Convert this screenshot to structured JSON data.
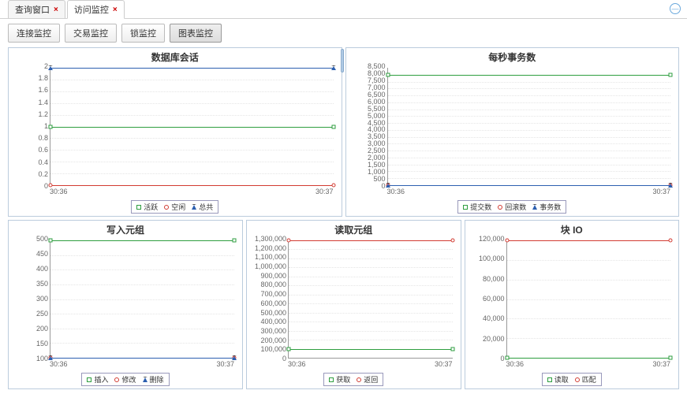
{
  "tabs": [
    {
      "label": "查询窗口",
      "active": false
    },
    {
      "label": "访问监控",
      "active": true
    }
  ],
  "subtabs": [
    {
      "label": "连接监控",
      "active": false
    },
    {
      "label": "交易监控",
      "active": false
    },
    {
      "label": "锁监控",
      "active": false
    },
    {
      "label": "图表监控",
      "active": true
    }
  ],
  "colors": {
    "green": "#2e9e3f",
    "red": "#d23b32",
    "blue": "#2c5fb0"
  },
  "xticks": [
    "30:36",
    "30:37"
  ],
  "chart_data": [
    {
      "id": "sessions",
      "title": "数据库会话",
      "type": "line",
      "x": [
        "30:36",
        "30:37"
      ],
      "ylim": [
        0,
        2.0
      ],
      "ystep": 0.2,
      "series": [
        {
          "name": "活跃",
          "color": "green",
          "shape": "sq",
          "values": [
            1.0,
            1.0
          ]
        },
        {
          "name": "空闲",
          "color": "red",
          "shape": "ci",
          "values": [
            0.0,
            0.0
          ]
        },
        {
          "name": "总共",
          "color": "blue",
          "shape": "tr",
          "values": [
            2.0,
            2.0
          ]
        }
      ]
    },
    {
      "id": "tps",
      "title": "每秒事务数",
      "type": "line",
      "x": [
        "30:36",
        "30:37"
      ],
      "ylim": [
        0,
        8500
      ],
      "ystep": 500,
      "series": [
        {
          "name": "提交数",
          "color": "green",
          "shape": "sq",
          "values": [
            8000,
            8000
          ]
        },
        {
          "name": "回滚数",
          "color": "red",
          "shape": "ci",
          "values": [
            0,
            0
          ]
        },
        {
          "name": "事务数",
          "color": "blue",
          "shape": "tr",
          "values": [
            0,
            0
          ]
        }
      ]
    },
    {
      "id": "tuples_write",
      "title": "写入元组",
      "type": "line",
      "x": [
        "30:36",
        "30:37"
      ],
      "ylim": [
        100,
        500
      ],
      "ystep": 50,
      "series": [
        {
          "name": "插入",
          "color": "green",
          "shape": "sq",
          "values": [
            500,
            500
          ]
        },
        {
          "name": "修改",
          "color": "red",
          "shape": "ci",
          "values": [
            100,
            100
          ]
        },
        {
          "name": "删除",
          "color": "blue",
          "shape": "tr",
          "values": [
            100,
            100
          ]
        }
      ]
    },
    {
      "id": "tuples_read",
      "title": "读取元组",
      "type": "line",
      "x": [
        "30:36",
        "30:37"
      ],
      "ylim": [
        0,
        1300000
      ],
      "ystep": 100000,
      "series": [
        {
          "name": "获取",
          "color": "green",
          "shape": "sq",
          "values": [
            100000,
            100000
          ]
        },
        {
          "name": "返回",
          "color": "red",
          "shape": "ci",
          "values": [
            1300000,
            1300000
          ]
        }
      ]
    },
    {
      "id": "block_io",
      "title": "块 IO",
      "type": "line",
      "x": [
        "30:36",
        "30:37"
      ],
      "ylim": [
        0,
        120000
      ],
      "ystep": 20000,
      "series": [
        {
          "name": "读取",
          "color": "green",
          "shape": "sq",
          "values": [
            0,
            0
          ]
        },
        {
          "name": "匹配",
          "color": "red",
          "shape": "ci",
          "values": [
            120000,
            120000
          ]
        }
      ]
    }
  ]
}
